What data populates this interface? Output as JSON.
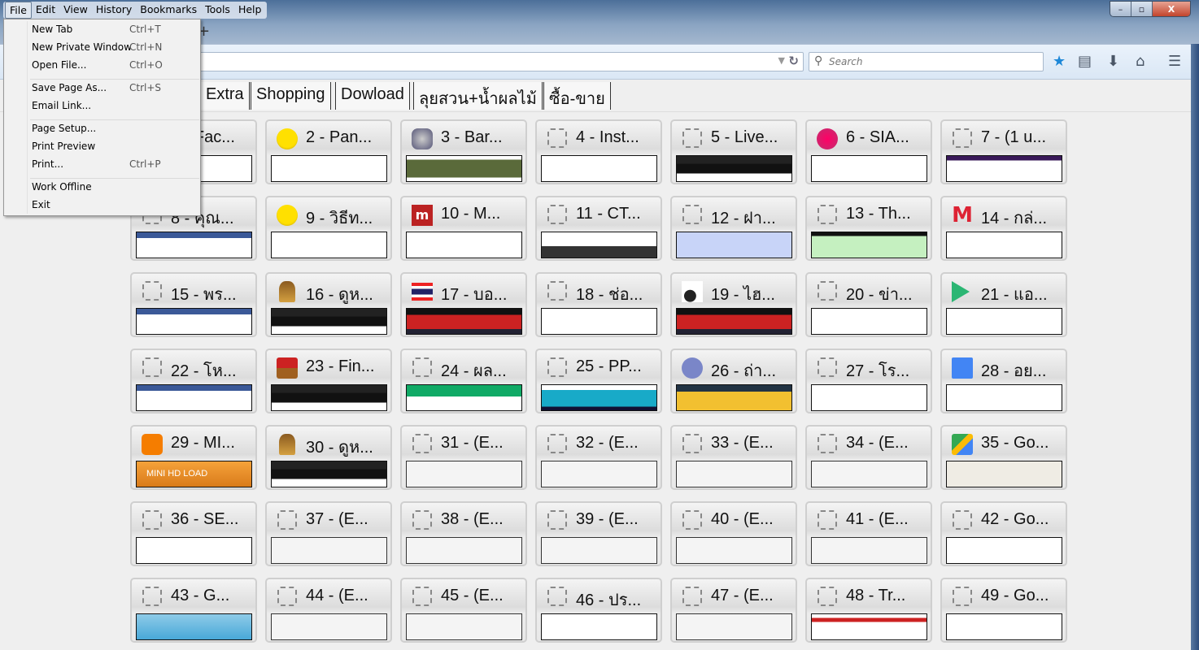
{
  "menubar": [
    "File",
    "Edit",
    "View",
    "History",
    "Bookmarks",
    "Tools",
    "Help"
  ],
  "window_controls": {
    "minimize": "–",
    "restore": "▫",
    "close": "X"
  },
  "newtab": "+",
  "search": {
    "placeholder": "Search"
  },
  "toolbar_icons": [
    "star-icon",
    "reading-list-icon",
    "download-icon",
    "home-icon",
    "hamburger-menu-icon"
  ],
  "accent": "#1e88d8",
  "bookmarks": [
    "Extra",
    "Shopping",
    "Dowload",
    "ลุยสวน+น้ำผลไม้",
    "ซื้อ-ขาย"
  ],
  "file_menu": [
    {
      "label": "New Tab",
      "key": "Ctrl+T"
    },
    {
      "label": "New Private Window",
      "key": "Ctrl+N"
    },
    {
      "label": "Open File...",
      "key": "Ctrl+O"
    },
    {
      "sep": true
    },
    {
      "label": "Save Page As...",
      "key": "Ctrl+S"
    },
    {
      "label": "Email Link...",
      "key": ""
    },
    {
      "sep": true
    },
    {
      "label": "Page Setup...",
      "key": ""
    },
    {
      "label": "Print Preview",
      "key": ""
    },
    {
      "label": "Print...",
      "key": "Ctrl+P"
    },
    {
      "sep": true
    },
    {
      "label": "Work Offline",
      "key": ""
    },
    {
      "label": "Exit",
      "key": ""
    }
  ],
  "tiles": [
    {
      "title": "1 - Fac...",
      "icon": "placeholder",
      "thumb": "white"
    },
    {
      "title": "2 - Pan...",
      "icon": "smiley",
      "thumb": "white"
    },
    {
      "title": "3 - Bar...",
      "icon": "pl",
      "thumb": "pl",
      "thumb_text": ""
    },
    {
      "title": "4 - Inst...",
      "icon": "placeholder",
      "thumb": "white"
    },
    {
      "title": "5 - Live...",
      "icon": "placeholder",
      "thumb": "dark"
    },
    {
      "title": "6 - SIA...",
      "icon": "pink",
      "thumb": "white"
    },
    {
      "title": "7 - (1 u...",
      "icon": "placeholder",
      "thumb": "purple"
    },
    {
      "title": "8 - คุณ...",
      "icon": "placeholder",
      "thumb": "fb"
    },
    {
      "title": "9 - วิธีท...",
      "icon": "smiley",
      "thumb": "white"
    },
    {
      "title": "10 - M...",
      "icon": "m88",
      "thumb": "white"
    },
    {
      "title": "11 - CT...",
      "icon": "placeholder",
      "thumb": "cth"
    },
    {
      "title": "12 - ฝา...",
      "icon": "placeholder",
      "thumb": "upic"
    },
    {
      "title": "13 - Th...",
      "icon": "placeholder",
      "thumb": "green"
    },
    {
      "title": "14 - กล่...",
      "icon": "gmail",
      "thumb": "white"
    },
    {
      "title": "15 - พร...",
      "icon": "placeholder",
      "thumb": "fb"
    },
    {
      "title": "16 - ดูห...",
      "icon": "cup",
      "thumb": "dark"
    },
    {
      "title": "17 - บอ...",
      "icon": "flag",
      "thumb": "red"
    },
    {
      "title": "18 - ช่อ...",
      "icon": "placeholder",
      "thumb": "white"
    },
    {
      "title": "19 - ไฮ...",
      "icon": "ball",
      "thumb": "red"
    },
    {
      "title": "20 - ข่า...",
      "icon": "placeholder",
      "thumb": "white"
    },
    {
      "title": "21 - แอ...",
      "icon": "play",
      "thumb": "white"
    },
    {
      "title": "22 - โห...",
      "icon": "placeholder",
      "thumb": "fb"
    },
    {
      "title": "23 - Fin...",
      "icon": "chair",
      "thumb": "dark"
    },
    {
      "title": "24 - ผล...",
      "icon": "placeholder",
      "thumb": "score"
    },
    {
      "title": "25 - PP...",
      "icon": "placeholder",
      "thumb": "teal"
    },
    {
      "title": "26 - ถ่า...",
      "icon": "owl",
      "thumb": "yellow"
    },
    {
      "title": "27 - โร...",
      "icon": "placeholder",
      "thumb": "white"
    },
    {
      "title": "28 - อย...",
      "icon": "classroom",
      "thumb": "white"
    },
    {
      "title": "29 - MI...",
      "icon": "blogger",
      "thumb": "orange",
      "thumb_text": "MINI HD LOAD"
    },
    {
      "title": "30 - ดูห...",
      "icon": "cup",
      "thumb": "dark"
    },
    {
      "title": "31 - (E...",
      "icon": "placeholder",
      "thumb": "grey"
    },
    {
      "title": "32 - (E...",
      "icon": "placeholder",
      "thumb": "grey"
    },
    {
      "title": "33 - (E...",
      "icon": "placeholder",
      "thumb": "grey"
    },
    {
      "title": "34 - (E...",
      "icon": "placeholder",
      "thumb": "grey"
    },
    {
      "title": "35 - Go...",
      "icon": "maps",
      "thumb": "beige"
    },
    {
      "title": "36 - SE...",
      "icon": "placeholder",
      "thumb": "white"
    },
    {
      "title": "37 - (E...",
      "icon": "placeholder",
      "thumb": "grey"
    },
    {
      "title": "38 - (E...",
      "icon": "placeholder",
      "thumb": "grey"
    },
    {
      "title": "39 - (E...",
      "icon": "placeholder",
      "thumb": "grey"
    },
    {
      "title": "40 - (E...",
      "icon": "placeholder",
      "thumb": "grey"
    },
    {
      "title": "41 - (E...",
      "icon": "placeholder",
      "thumb": "grey"
    },
    {
      "title": "42 - Go...",
      "icon": "placeholder",
      "thumb": "white"
    },
    {
      "title": "43 - G...",
      "icon": "placeholder",
      "thumb": "sky"
    },
    {
      "title": "44 - (E...",
      "icon": "placeholder",
      "thumb": "grey"
    },
    {
      "title": "45 - (E...",
      "icon": "placeholder",
      "thumb": "grey"
    },
    {
      "title": "46 - ปร...",
      "icon": "placeholder",
      "thumb": "white"
    },
    {
      "title": "47 - (E...",
      "icon": "placeholder",
      "thumb": "grey"
    },
    {
      "title": "48 - Tr...",
      "icon": "placeholder",
      "thumb": "redtop"
    },
    {
      "title": "49 - Go...",
      "icon": "placeholder",
      "thumb": "white"
    }
  ]
}
